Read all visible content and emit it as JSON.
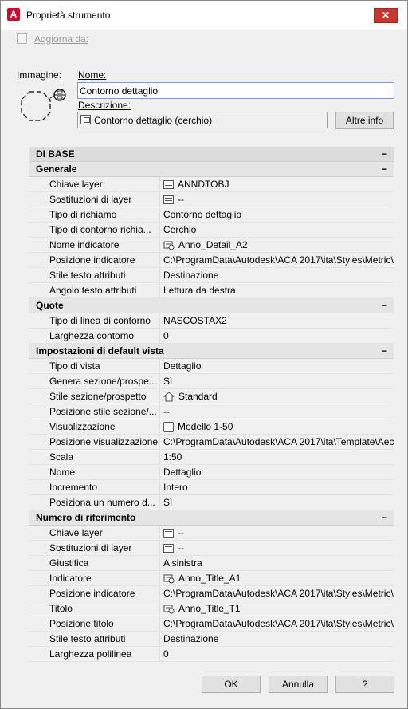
{
  "window": {
    "title": "Proprietà strumento",
    "close_glyph": "✕",
    "app_icon_letter": "A"
  },
  "update": {
    "label": "Aggiorna da:"
  },
  "image": {
    "label": "Immagine:",
    "icon": "detail-boundary-icon"
  },
  "name": {
    "label": "Nome:",
    "value": "Contorno dettaglio"
  },
  "description": {
    "label": "Descrizione:",
    "value": "Contorno dettaglio (cerchio)"
  },
  "more_info_button": "Altre info",
  "grid": {
    "top_category": {
      "label": "DI BASE",
      "toggle": "−"
    },
    "sections": [
      {
        "label": "Generale",
        "toggle": "−",
        "rows": [
          {
            "name": "Chiave layer",
            "value": "ANNDTOBJ",
            "icon": "layer-icon"
          },
          {
            "name": "Sostituzioni di layer",
            "value": "--",
            "icon": "layer-icon"
          },
          {
            "name": "Tipo di richiamo",
            "value": "Contorno dettaglio"
          },
          {
            "name": "Tipo di contorno richia...",
            "value": "Cerchio"
          },
          {
            "name": "Nome indicatore",
            "value": "Anno_Detail_A2",
            "icon": "indicator-icon"
          },
          {
            "name": "Posizione indicatore",
            "value": "C:\\ProgramData\\Autodesk\\ACA 2017\\ita\\Styles\\Metric\\Ita..."
          },
          {
            "name": "Stile testo attributi",
            "value": "Destinazione"
          },
          {
            "name": "Angolo testo attributi",
            "value": "Lettura da destra"
          }
        ]
      },
      {
        "label": "Quote",
        "toggle": "−",
        "rows": [
          {
            "name": "Tipo di linea di contorno",
            "value": "NASCOSTAX2"
          },
          {
            "name": "Larghezza contorno",
            "value": "0"
          }
        ]
      },
      {
        "label": "Impostazioni di default vista",
        "toggle": "−",
        "rows": [
          {
            "name": "Tipo di vista",
            "value": "Dettaglio"
          },
          {
            "name": "Genera  sezione/prospe...",
            "value": "Sì"
          },
          {
            "name": "Stile sezione/prospetto",
            "value": "Standard",
            "icon": "house-icon"
          },
          {
            "name": "Posizione  stile sezione/...",
            "value": "--"
          },
          {
            "name": "Visualizzazione",
            "value": "Modello 1-50",
            "icon": "view-icon"
          },
          {
            "name": "Posizione visualizzazione",
            "value": "C:\\ProgramData\\Autodesk\\ACA 2017\\ita\\Template\\Aec M..."
          },
          {
            "name": "Scala",
            "value": "1:50"
          },
          {
            "name": "Nome",
            "value": "Dettaglio"
          },
          {
            "name": "Incremento",
            "value": "Intero"
          },
          {
            "name": "Posiziona  un numero d...",
            "value": "Sì"
          }
        ]
      },
      {
        "label": "Numero di riferimento",
        "toggle": "−",
        "rows": [
          {
            "name": "Chiave layer",
            "value": "--",
            "icon": "layer-icon"
          },
          {
            "name": "Sostituzioni di layer",
            "value": "--",
            "icon": "layer-icon"
          },
          {
            "name": "Giustifica",
            "value": "A sinistra"
          },
          {
            "name": "Indicatore",
            "value": "Anno_Title_A1",
            "icon": "indicator-icon"
          },
          {
            "name": "Posizione indicatore",
            "value": "C:\\ProgramData\\Autodesk\\ACA 2017\\ita\\Styles\\Metric\\Ita..."
          },
          {
            "name": "Titolo",
            "value": "Anno_Title_T1",
            "icon": "indicator-icon"
          },
          {
            "name": "Posizione titolo",
            "value": "C:\\ProgramData\\Autodesk\\ACA 2017\\ita\\Styles\\Metric\\Ita..."
          },
          {
            "name": "Stile testo attributi",
            "value": "Destinazione"
          },
          {
            "name": "Larghezza polilinea",
            "value": "0"
          }
        ]
      }
    ]
  },
  "buttons": {
    "ok": "OK",
    "cancel": "Annulla",
    "help": "?"
  },
  "colors": {
    "close_button": "#c7372f",
    "app_icon": "#c8102e",
    "focus_border": "#7a9cd3"
  }
}
